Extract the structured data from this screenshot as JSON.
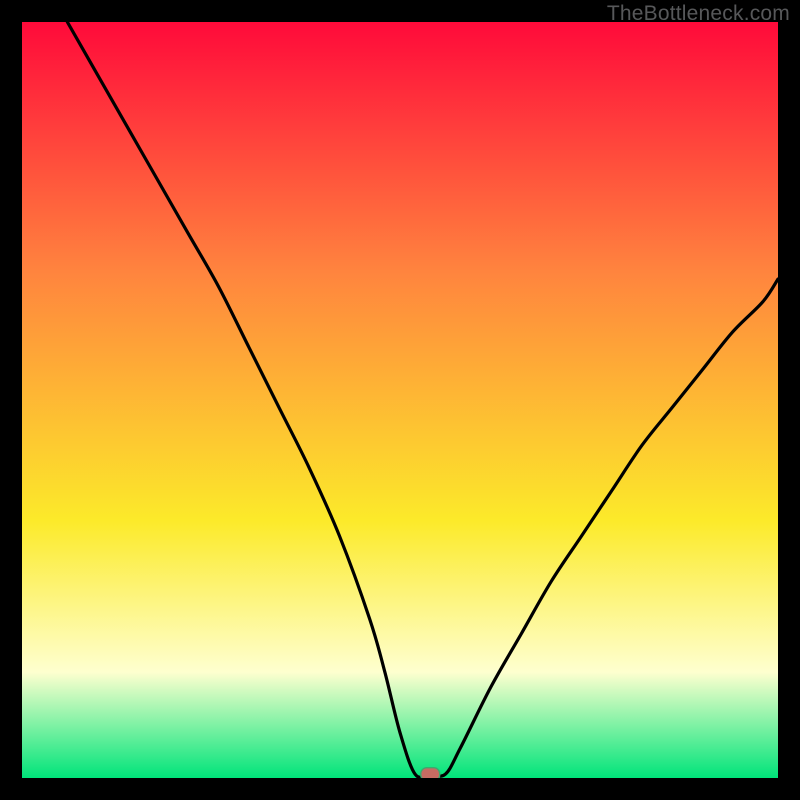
{
  "watermark": "TheBottleneck.com",
  "colors": {
    "gradient_top": "#ff0a3a",
    "gradient_mid_orange": "#ff843e",
    "gradient_mid_yellow": "#fcea2a",
    "gradient_pale": "#feffcf",
    "gradient_green": "#00e47a",
    "curve_stroke": "#000000",
    "marker_fill": "#c76b62",
    "marker_stroke": "#3fa86f",
    "background": "#000000"
  },
  "chart_data": {
    "type": "line",
    "title": "",
    "xlabel": "",
    "ylabel": "",
    "xlim": [
      0,
      100
    ],
    "ylim": [
      0,
      100
    ],
    "grid": false,
    "series": [
      {
        "name": "bottleneck-curve",
        "x": [
          6,
          10,
          14,
          18,
          22,
          26,
          30,
          34,
          38,
          42,
          46,
          48,
          50,
          52,
          54,
          56,
          58,
          62,
          66,
          70,
          74,
          78,
          82,
          86,
          90,
          94,
          98,
          100
        ],
        "y": [
          100,
          93,
          86,
          79,
          72,
          65,
          57,
          49,
          41,
          32,
          21,
          14,
          6,
          0.5,
          0.5,
          0.5,
          4,
          12,
          19,
          26,
          32,
          38,
          44,
          49,
          54,
          59,
          63,
          66
        ]
      }
    ],
    "annotations": [
      {
        "name": "optimal-marker",
        "x": 54,
        "y": 0.5
      }
    ]
  }
}
